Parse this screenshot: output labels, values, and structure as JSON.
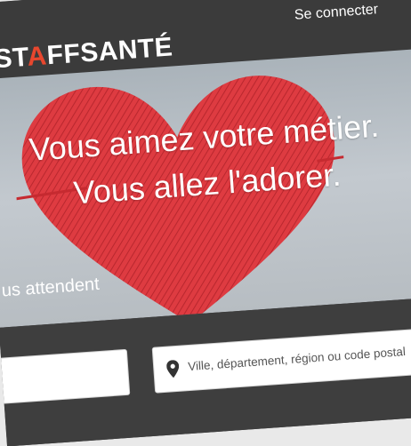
{
  "header": {
    "logo_pre": "ST",
    "logo_accent": "A",
    "logo_post": "FFSANTÉ",
    "login_label": "Se connecter"
  },
  "hero": {
    "headline_1": "Vous aimez votre métier.",
    "headline_2": "Vous allez l'adorer.",
    "subtitle": "us attendent"
  },
  "search": {
    "what_value": "",
    "location_placeholder": "Ville, département, région ou code postal"
  },
  "colors": {
    "brand_accent": "#e8472e",
    "heart": "#d8282e",
    "header_bg": "#3b3b3b"
  },
  "icons": {
    "location": "map-pin-icon"
  }
}
